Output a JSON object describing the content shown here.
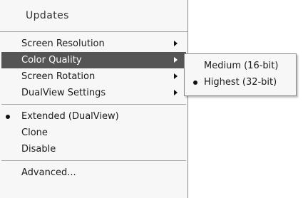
{
  "menu": {
    "header": "Updates",
    "group1": [
      {
        "label": "Screen Resolution",
        "has_submenu": true,
        "highlighted": false
      },
      {
        "label": "Color Quality",
        "has_submenu": true,
        "highlighted": true
      },
      {
        "label": "Screen Rotation",
        "has_submenu": true,
        "highlighted": false
      },
      {
        "label": "DualView Settings",
        "has_submenu": true,
        "highlighted": false
      }
    ],
    "group2": [
      {
        "label": "Extended (DualView)",
        "selected": true
      },
      {
        "label": "Clone",
        "selected": false
      },
      {
        "label": "Disable",
        "selected": false
      }
    ],
    "group3": [
      {
        "label": "Advanced..."
      }
    ]
  },
  "submenu": {
    "items": [
      {
        "label": "Medium (16-bit)",
        "selected": false
      },
      {
        "label": "Highest (32-bit)",
        "selected": true
      }
    ]
  },
  "colors": {
    "highlight": "#555555",
    "menu_background": "#f7f7f7"
  }
}
